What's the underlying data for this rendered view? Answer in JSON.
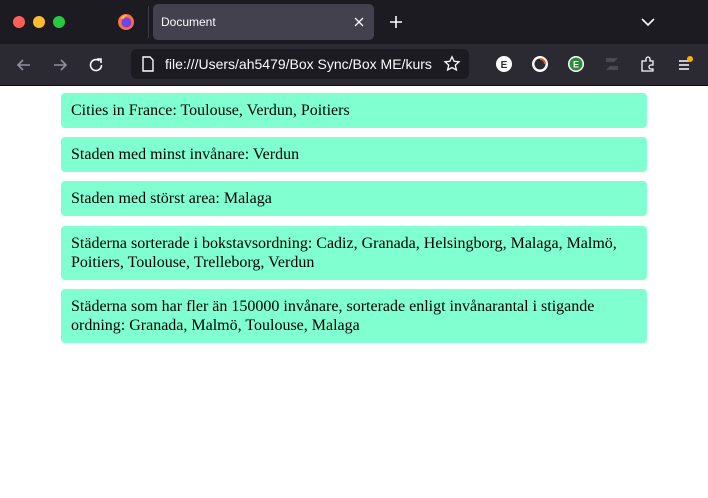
{
  "browser": {
    "tab_title": "Document",
    "url": "file:///Users/ah5479/Box Sync/Box ME/kurs",
    "extensions": [
      "evernote-icon",
      "clock-extension-icon",
      "e-extension-icon",
      "z-extension-icon",
      "puzzle-icon",
      "menu-icon"
    ]
  },
  "content": {
    "items": [
      {
        "text": "Cities in France: Toulouse, Verdun, Poitiers"
      },
      {
        "text": "Staden med minst invånare: Verdun"
      },
      {
        "text": "Staden med störst area: Malaga"
      },
      {
        "text": "Städerna sorterade i bokstavsordning: Cadiz, Granada, Helsingborg, Malaga, Malmö, Poitiers, Toulouse, Trelleborg, Verdun"
      },
      {
        "text": "Städerna som har fler än 150000 invånare, sorterade enligt invånarantal i stigande ordning: Granada, Malmö, Toulouse, Malaga"
      }
    ]
  },
  "colors": {
    "item_background": "#80ffd0",
    "chrome_dark": "#1c1b22",
    "toolbar": "#2b2a33"
  }
}
